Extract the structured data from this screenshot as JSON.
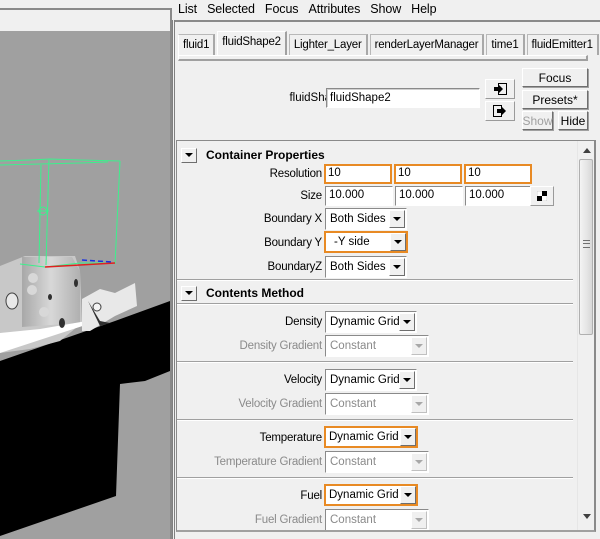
{
  "menubar": {
    "items": [
      "List",
      "Selected",
      "Focus",
      "Attributes",
      "Show",
      "Help"
    ]
  },
  "tabs": [
    {
      "label": "fluid1",
      "active": false
    },
    {
      "label": "fluidShape2",
      "active": true
    },
    {
      "label": "Lighter_Layer",
      "active": false
    },
    {
      "label": "renderLayerManager",
      "active": false
    },
    {
      "label": "time1",
      "active": false
    },
    {
      "label": "fluidEmitter1",
      "active": false
    }
  ],
  "node": {
    "label": "fluidShape:",
    "value": "fluidShape2",
    "icons": [
      "input-connection-icon",
      "output-connection-icon"
    ],
    "buttons": {
      "focus": "Focus",
      "presets": "Presets*",
      "show": "Show",
      "hide": "Hide"
    }
  },
  "highlight_color": "#e88a24",
  "sections": {
    "container": {
      "title": "Container Properties",
      "resolution": {
        "label": "Resolution",
        "values": [
          "10",
          "10",
          "10"
        ],
        "highlighted": true
      },
      "size": {
        "label": "Size",
        "values": [
          "10.000",
          "10.000",
          "10.000"
        ]
      },
      "boundary_x": {
        "label": "Boundary X",
        "value": "Both Sides",
        "highlighted": false
      },
      "boundary_y": {
        "label": "Boundary Y",
        "value": "-Y side",
        "highlighted": true
      },
      "boundary_z": {
        "label": "BoundaryZ",
        "value": "Both Sides",
        "highlighted": false
      }
    },
    "contents": {
      "title": "Contents Method",
      "groups": [
        {
          "label": "Density",
          "value": "Dynamic Grid",
          "highlighted": false,
          "gradient_label": "Density Gradient",
          "gradient_value": "Constant"
        },
        {
          "label": "Velocity",
          "value": "Dynamic Grid",
          "highlighted": false,
          "gradient_label": "Velocity Gradient",
          "gradient_value": "Constant"
        },
        {
          "label": "Temperature",
          "value": "Dynamic Grid",
          "highlighted": true,
          "gradient_label": "Temperature Gradient",
          "gradient_value": "Constant"
        },
        {
          "label": "Fuel",
          "value": "Dynamic Grid",
          "highlighted": true,
          "gradient_label": "Fuel Gradient",
          "gradient_value": "Constant"
        }
      ]
    }
  }
}
